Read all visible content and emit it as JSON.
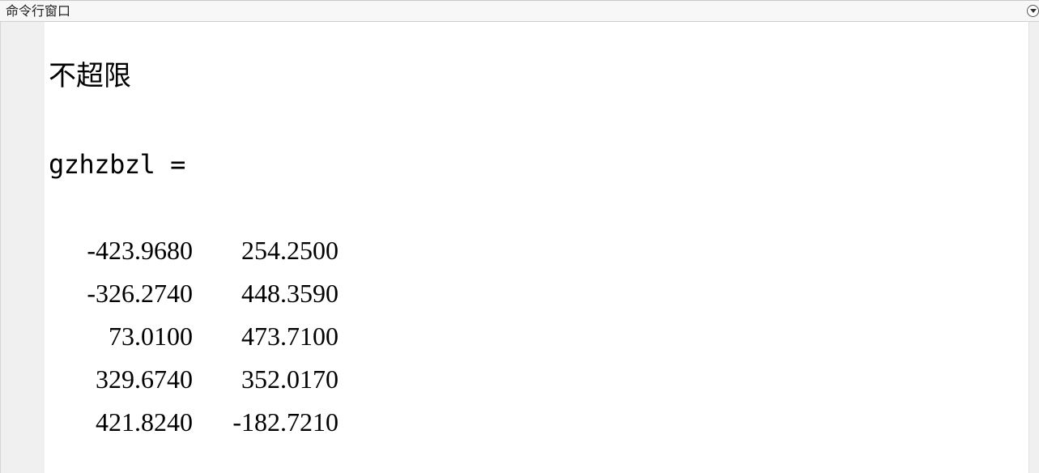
{
  "window": {
    "title": "命令行窗口"
  },
  "output": {
    "status_message": "不超限",
    "variable_line": "gzhzbzl =",
    "matrix": [
      [
        "-423.9680",
        "254.2500"
      ],
      [
        "-326.2740",
        "448.3590"
      ],
      [
        "73.0100",
        "473.7100"
      ],
      [
        "329.6740",
        "352.0170"
      ],
      [
        "421.8240",
        "-182.7210"
      ]
    ]
  },
  "icons": {
    "panel_menu": "chevron-down-circle-icon"
  }
}
